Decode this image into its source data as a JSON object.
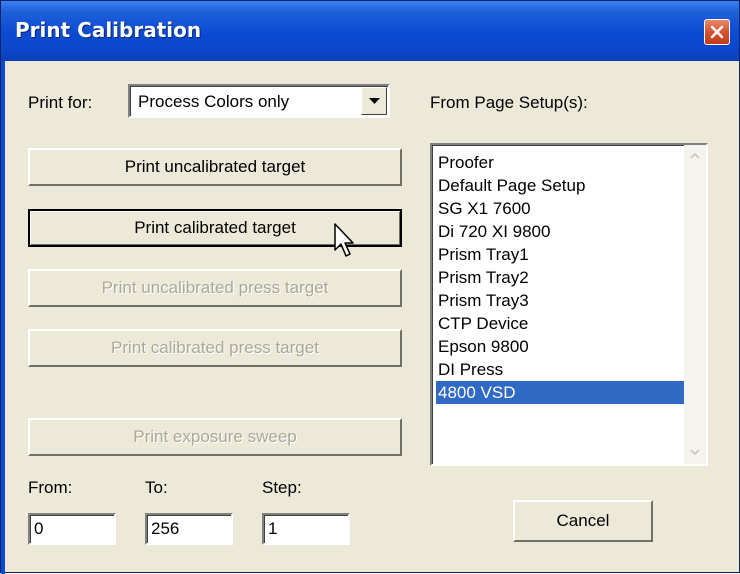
{
  "window": {
    "title": "Print Calibration"
  },
  "print_for": {
    "label": "Print for:",
    "selected": "Process Colors only"
  },
  "buttons": {
    "uncalibrated": "Print uncalibrated target",
    "calibrated": "Print calibrated target",
    "uncalibrated_press": "Print uncalibrated press target",
    "calibrated_press": "Print calibrated press target",
    "exposure_sweep": "Print exposure sweep",
    "cancel": "Cancel"
  },
  "page_setups": {
    "label": "From Page Setup(s):",
    "items": [
      "Proofer",
      "Default Page Setup",
      "SG X1 7600",
      "Di 720 XI 9800",
      "Prism Tray1",
      "Prism Tray2",
      "Prism Tray3",
      "CTP Device",
      "Epson 9800",
      "DI Press",
      "4800 VSD"
    ],
    "selected": "4800 VSD"
  },
  "sweep": {
    "from_label": "From:",
    "from_value": "0",
    "to_label": "To:",
    "to_value": "256",
    "step_label": "Step:",
    "step_value": "1"
  },
  "colors": {
    "title_bar": "#0a4bd4",
    "selection": "#316ac5",
    "dialog_bg": "#ece9d8",
    "close": "#d7522f"
  }
}
